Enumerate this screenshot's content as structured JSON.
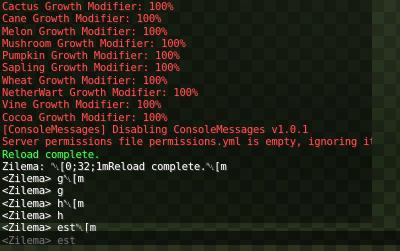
{
  "chat": {
    "lines": [
      {
        "text": "Cactus Growth Modifier: 100%",
        "color": "red"
      },
      {
        "text": "Cane Growth Modifier: 100%",
        "color": "red"
      },
      {
        "text": "Melon Growth Modifier: 100%",
        "color": "red"
      },
      {
        "text": "Mushroom Growth Modifier: 100%",
        "color": "red"
      },
      {
        "text": "Pumpkin Growth Modifier: 100%",
        "color": "red"
      },
      {
        "text": "Sapling Growth Modifier: 100%",
        "color": "red"
      },
      {
        "text": "Wheat Growth Modifier: 100%",
        "color": "red"
      },
      {
        "text": "NetherWart Growth Modifier: 100%",
        "color": "red"
      },
      {
        "text": "Vine Growth Modifier: 100%",
        "color": "red"
      },
      {
        "text": "Cocoa Growth Modifier: 100%",
        "color": "red"
      },
      {
        "text": "[ConsoleMessages] Disabling ConsoleMessages v1.0.1",
        "color": "red"
      },
      {
        "text": "Server permissions file permissions.yml is empty, ignoring it",
        "color": "red"
      },
      {
        "text": "Reload complete.",
        "color": "green"
      },
      {
        "text": "Zilema: ␀[0;32;1mReload complete.␀[m",
        "color": "white"
      },
      {
        "text": "<Zilema> g␀[m",
        "color": "white"
      },
      {
        "text": "<Zilema> g",
        "color": "white"
      },
      {
        "text": "<Zilema> h␀[m",
        "color": "white"
      },
      {
        "text": "<Zilema> h",
        "color": "white"
      },
      {
        "text": "<Zilema> est␀[m",
        "color": "white"
      },
      {
        "text": "<Zilema> est",
        "color": "white"
      }
    ]
  },
  "colors": {
    "red": "#ff5555",
    "green": "#55ff55",
    "white": "#ffffff"
  }
}
